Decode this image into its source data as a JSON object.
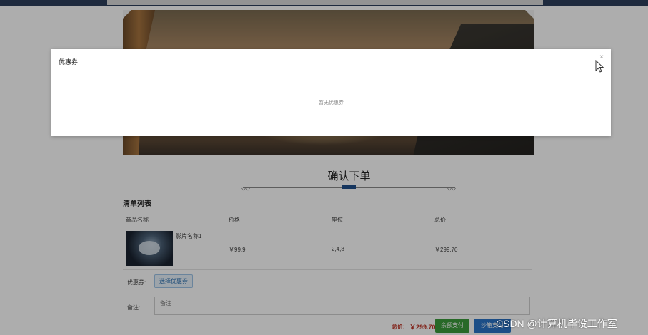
{
  "modal": {
    "title": "优惠券",
    "close_glyph": "×",
    "empty_text": "暂无优惠券"
  },
  "page": {
    "heading": "确认下单",
    "section_title": "清单列表",
    "columns": [
      "商品名称",
      "价格",
      "座位",
      "总价"
    ],
    "items": [
      {
        "name": "影片名称1",
        "price": "￥99.9",
        "seats": "2,4,8",
        "total": "￥299.70"
      }
    ],
    "coupon_label": "优惠券:",
    "coupon_button": "选择优惠券",
    "remark_label": "备注:",
    "remark_placeholder": "备注",
    "total_label": "总价:",
    "total_value": "￥299.70",
    "pay_balance": "余额支付",
    "pay_wechat": "沙箱支付"
  },
  "watermark": "CSDN @计算机毕设工作室",
  "colors": {
    "topbar": "#2d3f5c",
    "total_red": "#c0392b",
    "balance_green": "#3b9b3b",
    "wechat_blue": "#2a74c7",
    "heading_accent": "#1f4f8b"
  }
}
